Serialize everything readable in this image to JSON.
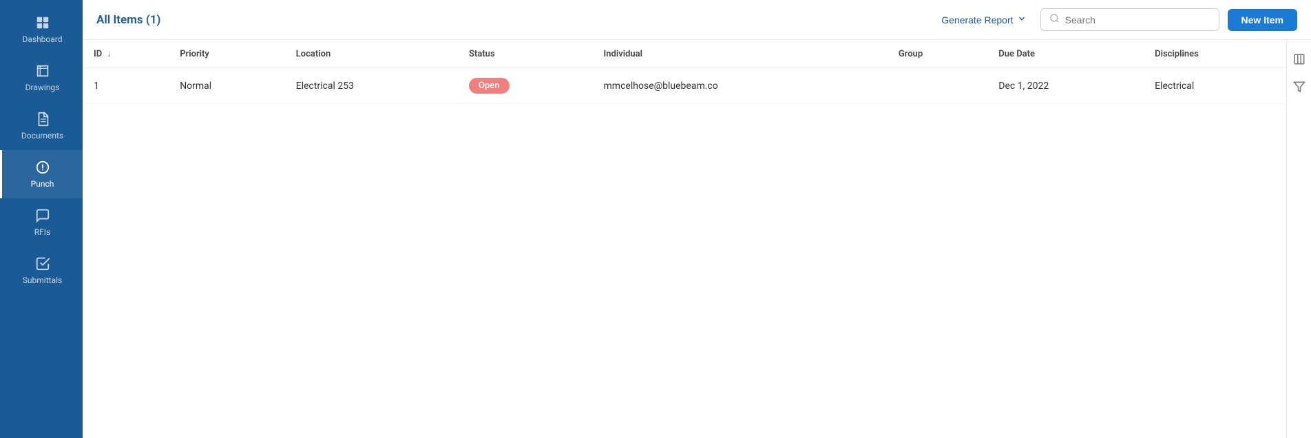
{
  "sidebar": {
    "items": [
      {
        "id": "dashboard",
        "label": "Dashboard",
        "icon": "dashboard-icon",
        "active": false
      },
      {
        "id": "drawings",
        "label": "Drawings",
        "icon": "drawings-icon",
        "active": false
      },
      {
        "id": "documents",
        "label": "Documents",
        "icon": "documents-icon",
        "active": false
      },
      {
        "id": "punch",
        "label": "Punch",
        "icon": "punch-icon",
        "active": true
      },
      {
        "id": "rfis",
        "label": "RFIs",
        "icon": "rfis-icon",
        "active": false
      },
      {
        "id": "submittals",
        "label": "Submittals",
        "icon": "submittals-icon",
        "active": false
      }
    ]
  },
  "header": {
    "title": "All Items",
    "count": "(1)",
    "generate_report_label": "Generate Report",
    "search_placeholder": "Search",
    "new_item_label": "New Item"
  },
  "table": {
    "columns": [
      "ID",
      "Priority",
      "Location",
      "Status",
      "Individual",
      "Group",
      "Due Date",
      "Disciplines"
    ],
    "rows": [
      {
        "id": "1",
        "priority": "Normal",
        "location": "Electrical 253",
        "status": "Open",
        "individual": "mmcelhose@bluebeam.co",
        "group": "",
        "due_date": "Dec 1, 2022",
        "disciplines": "Electrical"
      }
    ]
  },
  "right_sidebar": {
    "icons": [
      "table-icon",
      "filter-icon"
    ]
  }
}
